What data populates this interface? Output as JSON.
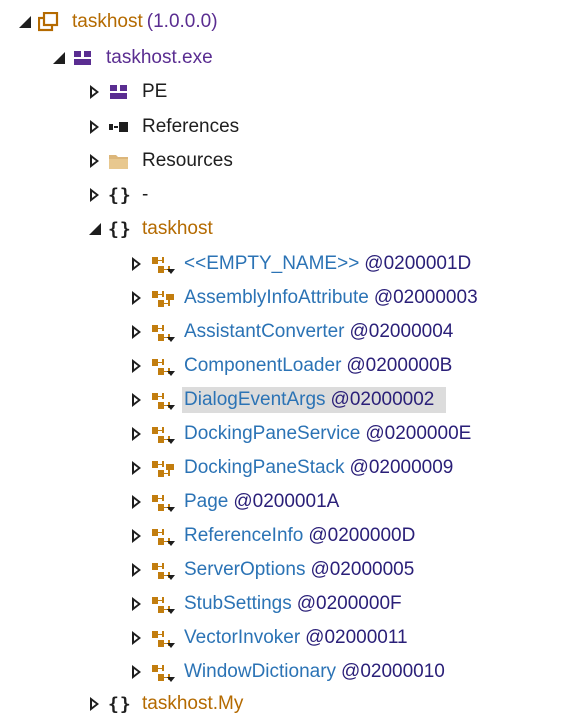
{
  "root": {
    "name": "taskhost",
    "version": "(1.0.0.0)",
    "module": {
      "name": "taskhost.exe",
      "children": [
        {
          "label": "PE",
          "icon": "pe-icon"
        },
        {
          "label": "References",
          "icon": "references-icon"
        },
        {
          "label": "Resources",
          "icon": "folder-icon"
        },
        {
          "label": "-",
          "icon": "namespace-icon"
        }
      ],
      "namespace": {
        "name": "taskhost",
        "types": [
          {
            "name": "<<EMPTY_NAME>>",
            "token": "@0200001D"
          },
          {
            "name": "AssemblyInfoAttribute",
            "token": "@02000003"
          },
          {
            "name": "AssistantConverter",
            "token": "@02000004"
          },
          {
            "name": "ComponentLoader",
            "token": "@0200000B"
          },
          {
            "name": "DialogEventArgs",
            "token": "@02000002"
          },
          {
            "name": "DockingPaneService",
            "token": "@0200000E"
          },
          {
            "name": "DockingPaneStack",
            "token": "@02000009"
          },
          {
            "name": "Page",
            "token": "@0200001A"
          },
          {
            "name": "ReferenceInfo",
            "token": "@0200000D"
          },
          {
            "name": "ServerOptions",
            "token": "@02000005"
          },
          {
            "name": "StubSettings",
            "token": "@0200000F"
          },
          {
            "name": "VectorInvoker",
            "token": "@02000011"
          },
          {
            "name": "WindowDictionary",
            "token": "@02000010"
          }
        ]
      },
      "next_namespace": "taskhost.My"
    }
  },
  "colors": {
    "assembly": "#b46a00",
    "module": "#5a2d91",
    "type": "#2b73b5",
    "token": "#2a1f78",
    "selection": "#dcdcdc"
  }
}
